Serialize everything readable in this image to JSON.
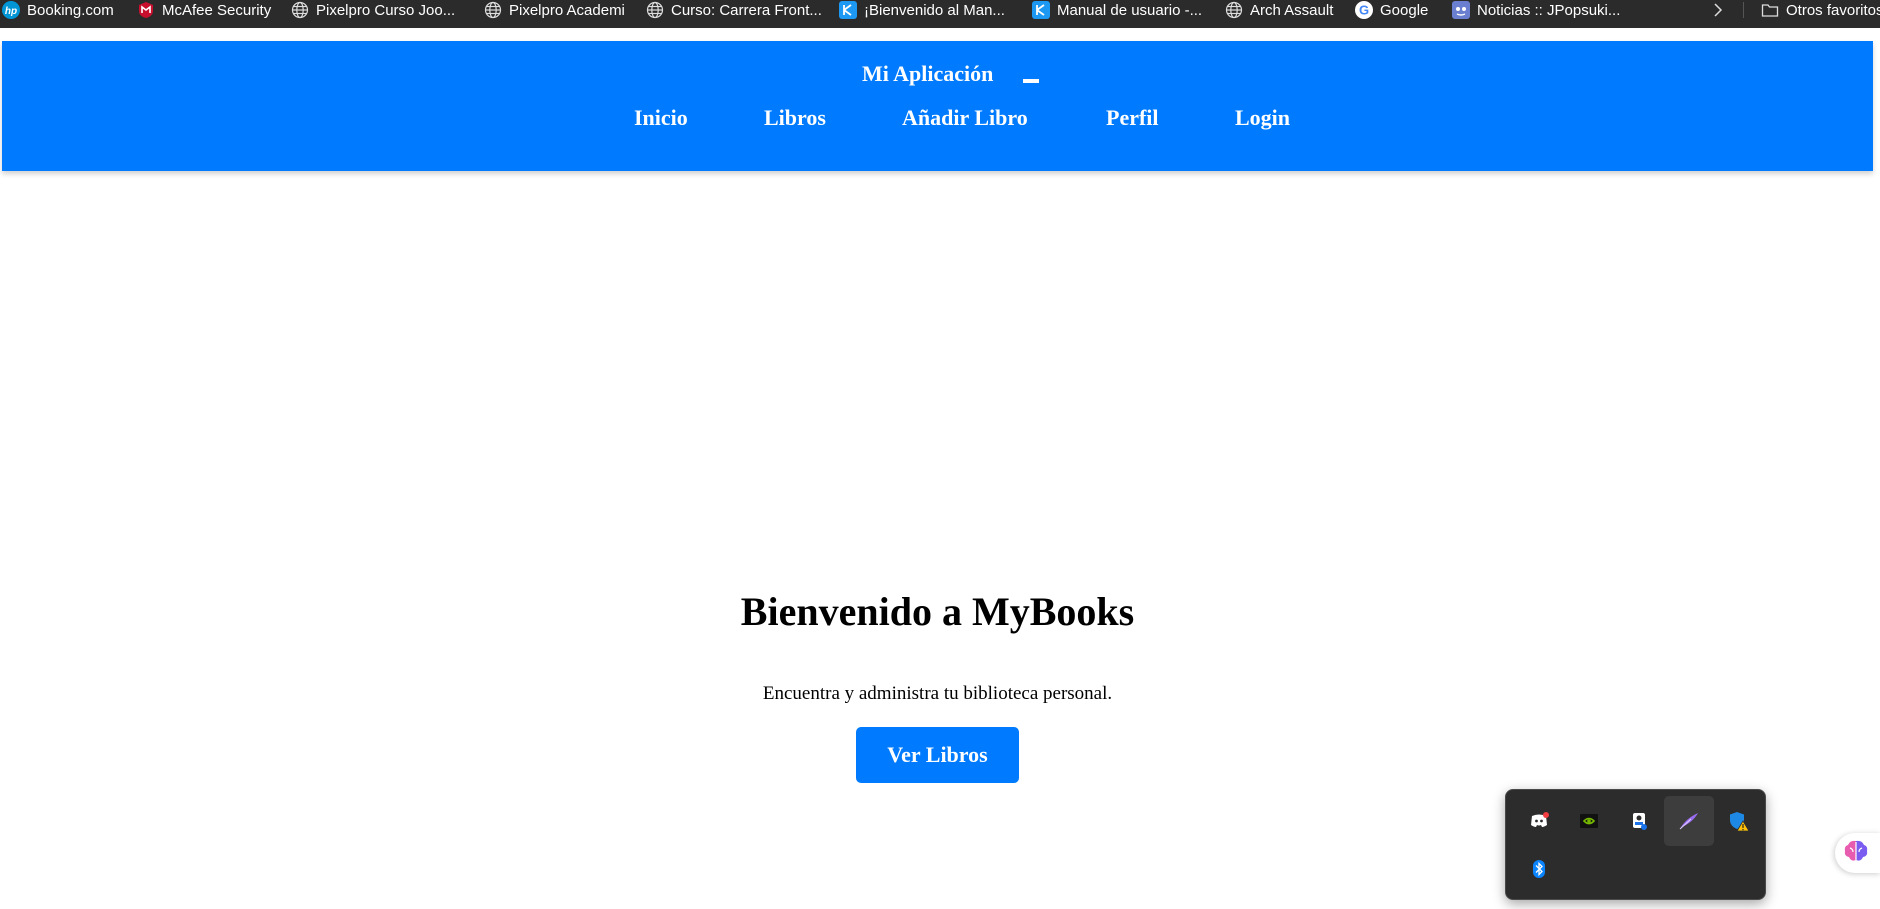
{
  "bookmarks": {
    "items": [
      {
        "label": "Booking.com",
        "icon": "hp-icon"
      },
      {
        "label": "McAfee Security",
        "icon": "mcafee-icon"
      },
      {
        "label": "Pixelpro Curso Joo...",
        "icon": "globe-icon"
      },
      {
        "label": "Pixelpro Academi",
        "icon": "globe-icon"
      },
      {
        "label": "Curso: Carrera Front...",
        "icon": "globe-icon"
      },
      {
        "label": "¡Bienvenido al Man...",
        "icon": "kde-icon"
      },
      {
        "label": "Manual de usuario -...",
        "icon": "kde-icon"
      },
      {
        "label": "Arch Assault",
        "icon": "globe-icon"
      },
      {
        "label": "Google",
        "icon": "google-icon"
      },
      {
        "label": "Noticias :: JPopsuki...",
        "icon": "jpopsuki-icon"
      }
    ],
    "other_label": "Otros favoritos"
  },
  "header": {
    "title": "Mi Aplicación",
    "nav": [
      "Inicio",
      "Libros",
      "Añadir Libro",
      "Perfil",
      "Login"
    ]
  },
  "hero": {
    "title": "Bienvenido a MyBooks",
    "subtitle": "Encuentra y administra tu biblioteca personal.",
    "button": "Ver Libros"
  },
  "tray": {
    "icons": [
      "discord-icon",
      "nvidia-icon",
      "security-agent-icon",
      "feather-icon",
      "defender-warning-icon",
      "bluetooth-icon"
    ]
  },
  "colors": {
    "primary": "#007bff",
    "bookmark_bar": "#2b2b2b",
    "tray_bg": "#2c2c2c"
  }
}
